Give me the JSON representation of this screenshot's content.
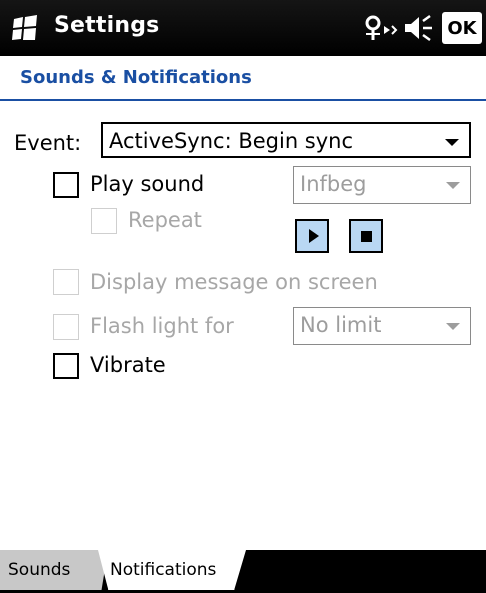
{
  "titlebar": {
    "title": "Settings",
    "ok_label": "OK"
  },
  "page": {
    "title": "Sounds & Notifications"
  },
  "event": {
    "label": "Event:",
    "value": "ActiveSync: Begin sync"
  },
  "options": {
    "play_sound": {
      "label": "Play sound",
      "checked": false,
      "enabled": true
    },
    "sound_file": {
      "value": "Infbeg",
      "enabled": false
    },
    "repeat": {
      "label": "Repeat",
      "checked": false,
      "enabled": false
    },
    "display_message": {
      "label": "Display message on screen",
      "checked": false,
      "enabled": false
    },
    "flash_light": {
      "label": "Flash light for",
      "checked": false,
      "enabled": false
    },
    "flash_duration": {
      "value": "No limit",
      "enabled": false
    },
    "vibrate": {
      "label": "Vibrate",
      "checked": false,
      "enabled": true
    }
  },
  "tabs": [
    {
      "label": "Sounds",
      "active": false
    },
    {
      "label": "Notifications",
      "active": true
    }
  ],
  "colors": {
    "header_text": "#1a4fa3",
    "titlebar_bg": "#000000",
    "button_fill": "#b9d7f3",
    "disabled_text": "#a7a7a7"
  }
}
